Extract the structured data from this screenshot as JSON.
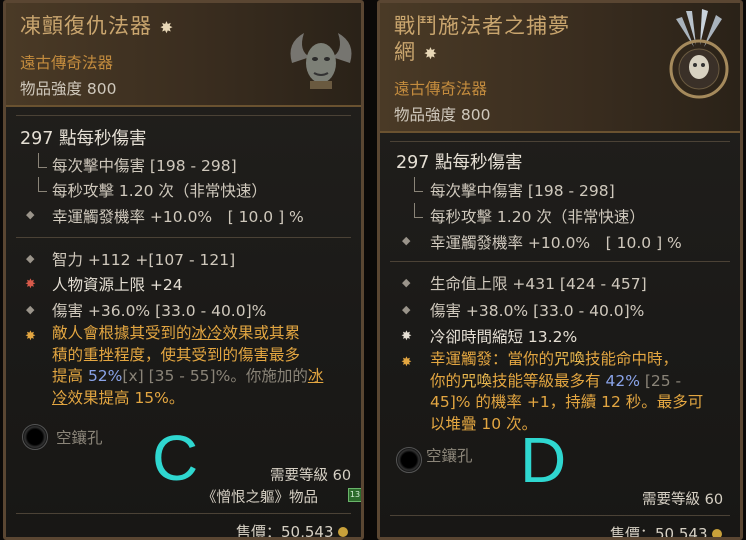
{
  "card_c": {
    "title": "凍顫復仇法器",
    "star": "✸",
    "rarity": "遠古傳奇法器",
    "power": "物品強度 800",
    "dps": "297 點每秒傷害",
    "damage_per_hit": "每次擊中傷害 [198 - 298]",
    "attack_speed": "每秒攻擊 1.20 次（非常快速）",
    "lucky_hit": "幸運觸發機率 +10.0%　[ 10.0 ] %",
    "affix_1": "智力 +112 +[107 - 121]",
    "affix_2": "人物資源上限 +24",
    "affix_3": "傷害 +36.0% [33.0 - 40.0]%",
    "unique_1": "敵人會根據其受到的",
    "unique_1b": "冰冷",
    "unique_1c": "效果或其累",
    "unique_2": "積的重挫程度，使其受到的傷害最多",
    "unique_3a": "提高 ",
    "unique_3b": "52%",
    "unique_3c": "[x]",
    "unique_3d": " [35 - 55]%。你施加的",
    "unique_3e": "冰",
    "unique_4a": "冷",
    "unique_4b": "效果提高 15%。",
    "socket": "空鑲孔",
    "letter": "C",
    "required_level": "需要等級 60",
    "source": "《憎恨之軀》物品",
    "price_label": "售價：50,543"
  },
  "card_d": {
    "title_1": "戰鬥施法者之捕夢",
    "title_2": "網",
    "star": "✸",
    "rarity": "遠古傳奇法器",
    "power": "物品強度 800",
    "dps": "297 點每秒傷害",
    "damage_per_hit": "每次擊中傷害 [198 - 298]",
    "attack_speed": "每秒攻擊 1.20 次（非常快速）",
    "lucky_hit": "幸運觸發機率 +10.0%　[ 10.0 ] %",
    "affix_1": "生命值上限 +431 [424 - 457]",
    "affix_2": "傷害 +38.0% [33.0 - 40.0]%",
    "affix_3": "冷卻時間縮短 13.2%",
    "unique_1a": "幸運觸發：當你的",
    "unique_1b": "咒喚",
    "unique_1c": "技能命中時，",
    "unique_2a": "你的",
    "unique_2b": "咒喚",
    "unique_2c": "技能等級最多有 ",
    "unique_2d": "42%",
    "unique_2e": " [25 -",
    "unique_3": "45]% 的機率 +1，持續 12 秒。最多可",
    "unique_4": "以堆疊 10 次。",
    "socket": "空鑲孔",
    "letter": "D",
    "required_level": "需要等級 60",
    "price_label": "售價：50,543"
  },
  "colors": {
    "unique_text": "#e3a641",
    "letter": "#2fd7d0",
    "title": "#c9a56e",
    "rarity": "#c48c3e"
  }
}
